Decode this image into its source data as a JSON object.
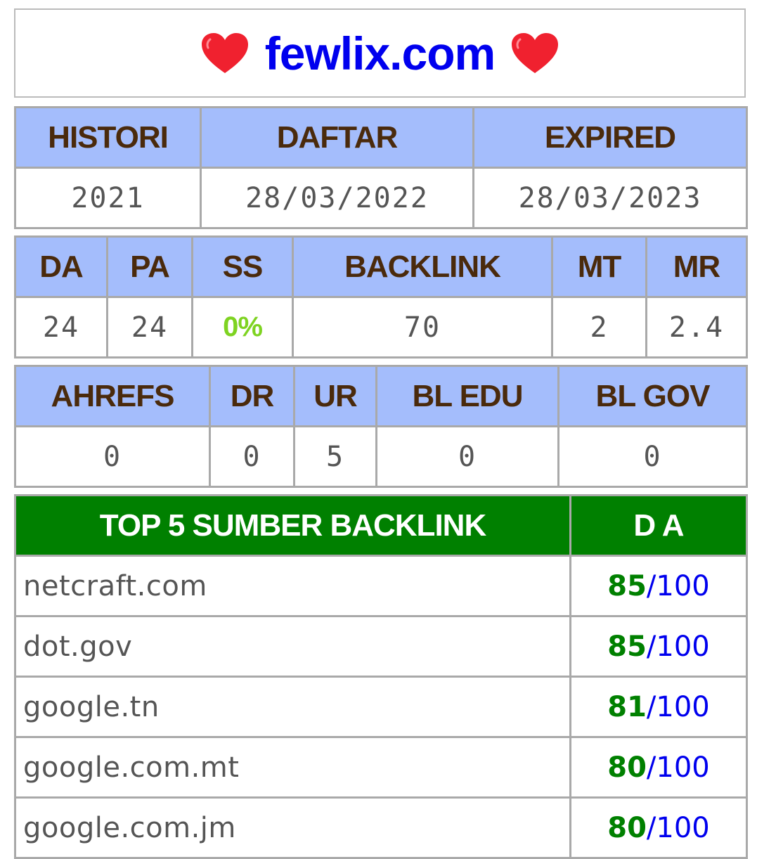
{
  "header": {
    "site": "fewlix.com",
    "left_icon": "red-heart-icon",
    "right_icon": "red-heart-icon",
    "heart_color": "#f0212f"
  },
  "dates": {
    "headers": [
      "HISTORI",
      "DAFTAR",
      "EXPIRED"
    ],
    "values": [
      "2021",
      "28/03/2022",
      "28/03/2023"
    ]
  },
  "metrics": {
    "headers": [
      "DA",
      "PA",
      "SS",
      "BACKLINK",
      "MT",
      "MR"
    ],
    "values": [
      "24",
      "24",
      "0%",
      "70",
      "2",
      "2.4"
    ]
  },
  "ahrefs": {
    "headers": [
      "AHREFS",
      "DR",
      "UR",
      "BL EDU",
      "BL GOV"
    ],
    "values": [
      "0",
      "0",
      "5",
      "0",
      "0"
    ]
  },
  "backlinks": {
    "headers": [
      "TOP 5 SUMBER BACKLINK",
      "D A"
    ],
    "rows": [
      {
        "source": "netcraft.com",
        "score": "85",
        "sep": "/",
        "max": "100"
      },
      {
        "source": "dot.gov",
        "score": "85",
        "sep": "/",
        "max": "100"
      },
      {
        "source": "google.tn",
        "score": "81",
        "sep": "/",
        "max": "100"
      },
      {
        "source": "google.com.mt",
        "score": "80",
        "sep": "/",
        "max": "100"
      },
      {
        "source": "google.com.jm",
        "score": "80",
        "sep": "/",
        "max": "100"
      }
    ]
  },
  "colors": {
    "header_blue": "#a4bdfc",
    "header_green": "#008000",
    "header_text": "#4a2a0c",
    "link_blue": "#0000ee",
    "ss_green": "#7ed321"
  }
}
